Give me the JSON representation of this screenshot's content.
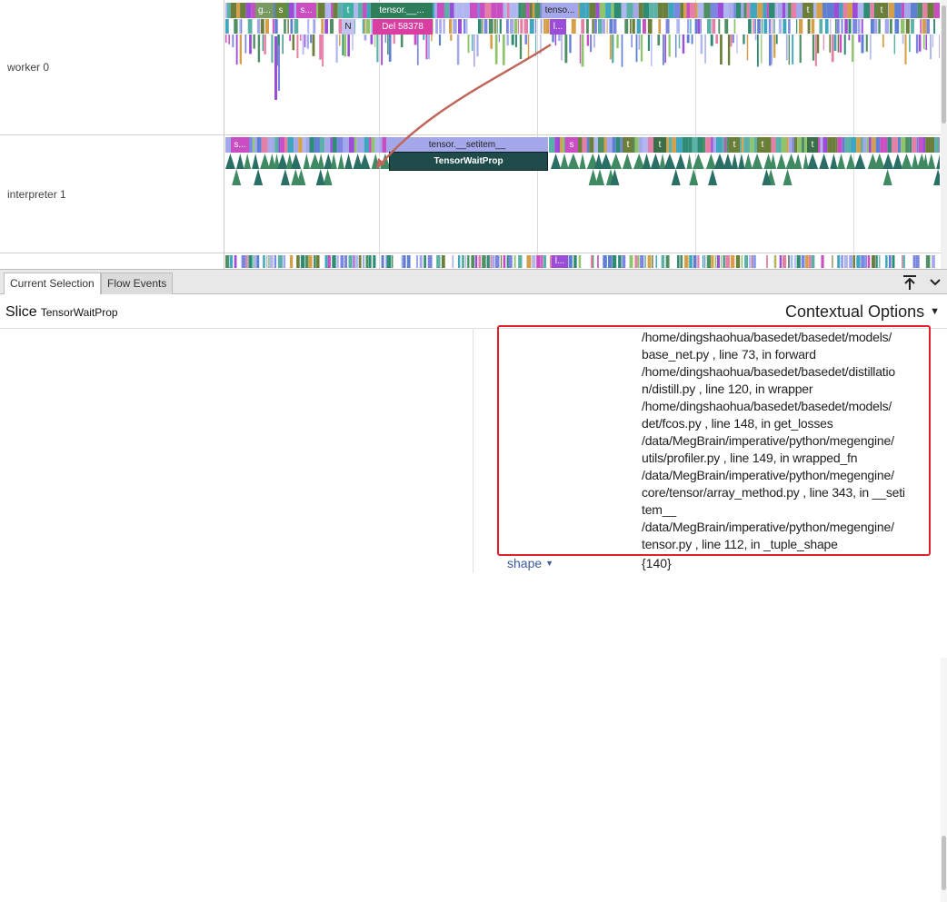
{
  "tracks": [
    {
      "label": "worker 0"
    },
    {
      "label": "interpreter 1"
    },
    {
      "label": "⋯"
    }
  ],
  "timeline_labels": {
    "w_g": "g...",
    "w_s1": "s",
    "w_s2": "s...",
    "w_t1": "t",
    "w_n": "N",
    "w_tensor": "tensor.__...",
    "w_del": "Del 58378",
    "w_tenso": "tenso...",
    "w_l": "l...",
    "w_t2": "t",
    "w_t3": "t",
    "i_s": "s...",
    "i_setitem": "tensor.__setitem__",
    "i_waitprop": "TensorWaitProp",
    "i_s2": "s",
    "i_t1": "t",
    "i_t2": "t",
    "i_t3": "t",
    "i_t4": "t",
    "i_t5": "t",
    "b_l": "l..."
  },
  "tabs": [
    {
      "label": "Current Selection",
      "active": true
    },
    {
      "label": "Flow Events",
      "active": false
    }
  ],
  "details": {
    "kind": "Slice",
    "name": "TensorWaitProp",
    "context_options": "Contextual Options",
    "stack_lines": [
      "/home/dingshaohua/basedet/basedet/models/",
      "base_net.py , line 73, in forward",
      "/home/dingshaohua/basedet/basedet/distillatio",
      "n/distill.py , line 120, in wrapper",
      "/home/dingshaohua/basedet/basedet/models/",
      "det/fcos.py , line 148, in get_losses",
      "/data/MegBrain/imperative/python/megengine/",
      "utils/profiler.py , line 149, in wrapped_fn",
      "/data/MegBrain/imperative/python/megengine/",
      "core/tensor/array_method.py , line 343, in __seti",
      "tem__",
      "/data/MegBrain/imperative/python/megengine/",
      "tensor.py , line 112, in _tuple_shape"
    ],
    "shape_key": "shape",
    "shape_value": "{140}"
  },
  "colors": {
    "highlight": "#e0202a",
    "waitprop_bg": "#1f4b4b",
    "setitem_bg": "#a4a8ea",
    "del_bg": "#d93fa0",
    "flow_arrow": "#c0665a"
  },
  "icons": {
    "expand": "arrow-up-bar-icon",
    "collapse": "chevron-down-icon"
  }
}
